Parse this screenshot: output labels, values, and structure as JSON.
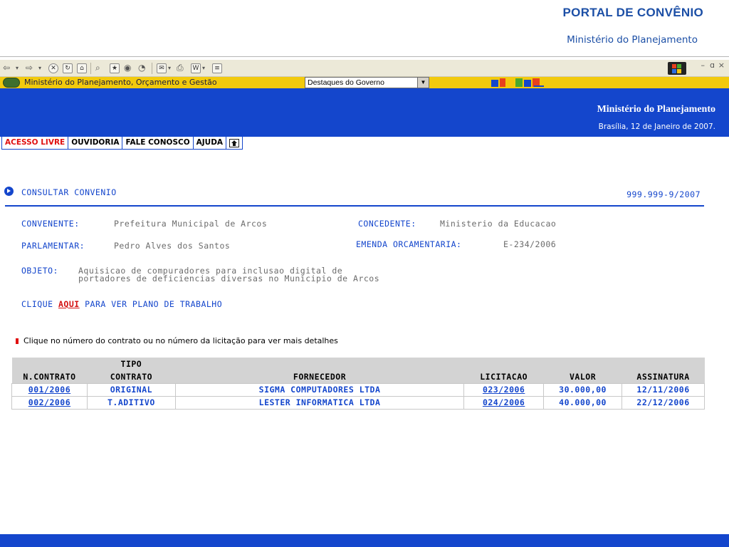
{
  "header": {
    "portal_title": "PORTAL DE CONVÊNIO",
    "subtitle": "Ministério do Planejamento"
  },
  "browser": {
    "address_text": "Ministério do Planejamento, Orçamento e Gestão",
    "gov_select_value": "Destaques do Governo",
    "controls": {
      "minimize": "–",
      "restore": "ɑ",
      "close": "×"
    }
  },
  "banner": {
    "title": "Ministério do Planejamento",
    "date": "Brasília, 12 de Janeiro de 2007."
  },
  "nav": {
    "tabs": [
      "ACESSO LIVRE",
      "OUVIDORIA",
      "FALE CONOSCO",
      "AJUDA"
    ]
  },
  "section": {
    "title": "CONSULTAR CONVENIO",
    "number": "999.999-9/2007"
  },
  "details": {
    "convenente_label": "CONVENENTE:",
    "convenente_value": "Prefeitura Municipal de Arcos",
    "concedente_label": "CONCEDENTE:",
    "concedente_value": "Ministerio da Educacao",
    "parlamentar_label": "PARLAMENTAR:",
    "parlamentar_value": "Pedro Alves dos Santos",
    "emenda_label": "EMENDA ORCAMENTARIA:",
    "emenda_value": "E-234/2006",
    "objeto_label": "OBJETO:",
    "objeto_line1": "Aquisicao de compuradores para inclusao digital de",
    "objeto_line2": "portadores de deficiencias diversas no Municipio de Arcos"
  },
  "plan_link": {
    "prefix": "CLIQUE",
    "link": "AQUI",
    "suffix": "PARA VER PLANO DE TRABALHO"
  },
  "note": "Clique no número do contrato ou no número da licitação para ver mais detalhes",
  "table": {
    "headers": {
      "tipo_top": "TIPO",
      "n_contrato": "N.CONTRATO",
      "contrato": "CONTRATO",
      "fornecedor": "FORNECEDOR",
      "licitacao": "LICITACAO",
      "valor": "VALOR",
      "assinatura": "ASSINATURA"
    },
    "rows": [
      {
        "contrato": "001/2006",
        "tipo": "ORIGINAL",
        "fornecedor": "SIGMA COMPUTADORES LTDA",
        "licitacao": "023/2006",
        "valor": "30.000,00",
        "assinatura": "12/11/2006"
      },
      {
        "contrato": "002/2006",
        "tipo": "T.ADITIVO",
        "fornecedor": "LESTER INFORMATICA LTDA",
        "licitacao": "024/2006",
        "valor": "40.000,00",
        "assinatura": "22/12/2006"
      }
    ]
  },
  "colors": {
    "primary_blue": "#1446cc",
    "accent_red": "#e01010",
    "address_yellow": "#f2ca0d"
  }
}
